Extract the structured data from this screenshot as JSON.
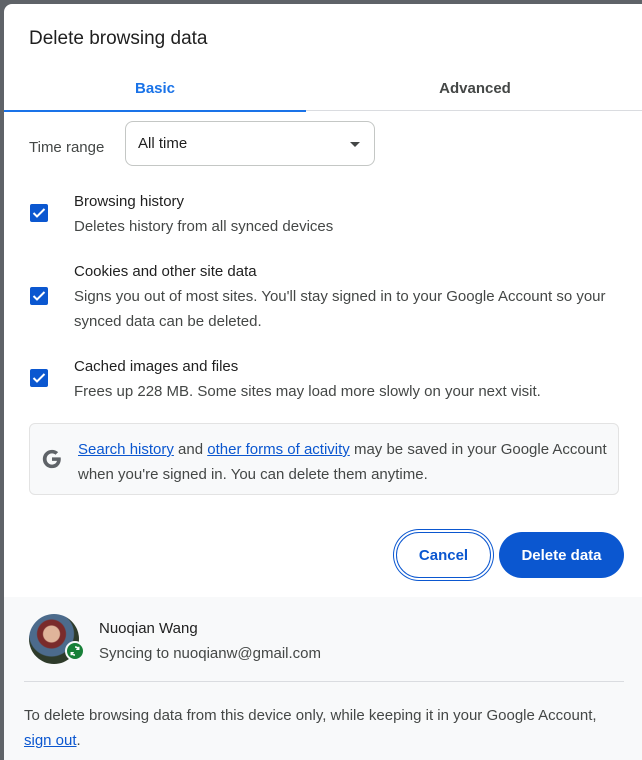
{
  "dialog": {
    "title": "Delete browsing data"
  },
  "tabs": [
    {
      "label": "Basic",
      "selected": true
    },
    {
      "label": "Advanced",
      "selected": false
    }
  ],
  "time_range": {
    "label": "Time range",
    "value": "All time"
  },
  "options": [
    {
      "title": "Browsing history",
      "desc": "Deletes history from all synced devices",
      "checked": true
    },
    {
      "title": "Cookies and other site data",
      "desc": "Signs you out of most sites. You'll stay signed in to your Google Account so your synced data can be deleted.",
      "checked": true
    },
    {
      "title": "Cached images and files",
      "desc": "Frees up 228 MB. Some sites may load more slowly on your next visit.",
      "checked": true
    }
  ],
  "info": {
    "link1": "Search history",
    "mid": " and ",
    "link2": "other forms of activity",
    "rest": " may be saved in your Google Account when you're signed in. You can delete them anytime."
  },
  "buttons": {
    "cancel": "Cancel",
    "delete": "Delete data"
  },
  "account": {
    "name": "Nuoqian Wang",
    "sync_status": "Syncing to nuoqianw@gmail.com"
  },
  "footer": {
    "note_before": "To delete browsing data from this device only, while keeping it in your Google Account, ",
    "link": "sign out",
    "note_after": "."
  },
  "colors": {
    "accent": "#0b57d0",
    "tab_active": "#1a73e8",
    "sync_badge": "#188038"
  }
}
